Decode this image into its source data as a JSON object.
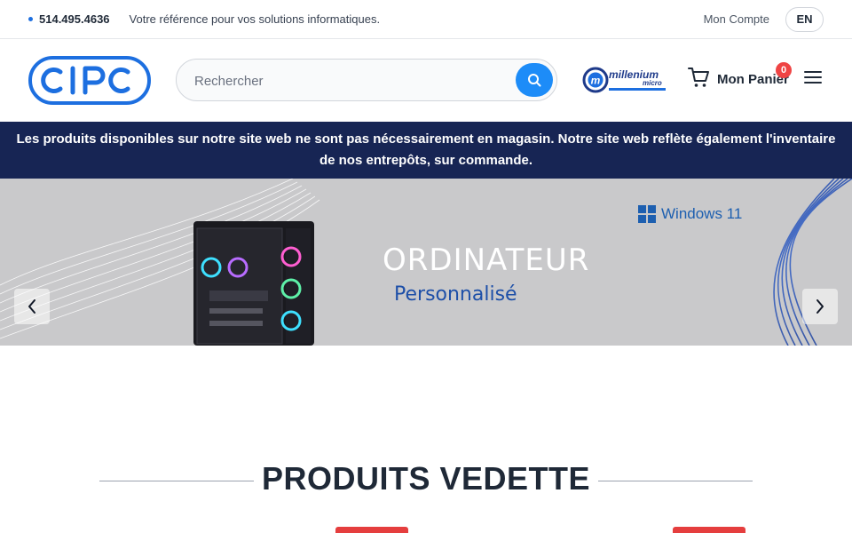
{
  "topbar": {
    "phone": "514.495.4636",
    "tagline": "Votre référence pour vos solutions informatiques.",
    "account_label": "Mon Compte",
    "language_label": "EN"
  },
  "header": {
    "logo_text": "CIPC",
    "search_placeholder": "Rechercher",
    "partner_logo_text": "millenium micro",
    "cart_label": "Mon Panier",
    "cart_count": "0"
  },
  "notice": {
    "text": "Les produits disponibles sur notre site web ne sont pas nécessairement en magasin. Notre site web reflète également l'inventaire de nos entrepôts, sur commande."
  },
  "hero": {
    "title": "ORDINATEUR",
    "subtitle": "Personnalisé",
    "badge_text": "Windows 11",
    "prev_icon": "chevron-left-icon",
    "next_icon": "chevron-right-icon"
  },
  "featured": {
    "title": "PRODUITS VEDETTE"
  },
  "colors": {
    "brand_blue": "#1d6fe0",
    "search_button": "#1d8cf8",
    "notice_bg": "#172554",
    "badge_red": "#ef4444",
    "hero_bg": "#c9c9cb"
  }
}
